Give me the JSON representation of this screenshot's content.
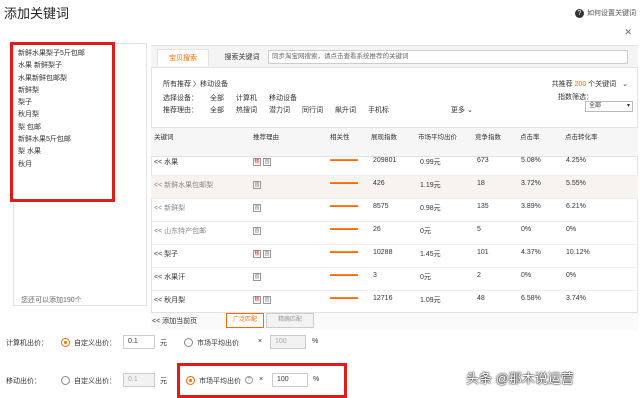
{
  "header": {
    "title": "添加关键词",
    "help_label": "如何设置关键词",
    "help_icon": "?",
    "close_icon": "✕"
  },
  "left": {
    "keywords": [
      "新鲜水果梨子5斤包邮",
      "水果 新鲜梨子",
      "水果新鲜包邮梨",
      "新鲜梨",
      "梨子",
      "秋月梨",
      "梨 包邮",
      "新鲜水果5斤包邮",
      "梨 水果",
      "秋月"
    ],
    "footer": "您还可以添加190个"
  },
  "tabs": {
    "active": "宝贝搜索",
    "other": "搜索关键词"
  },
  "search": {
    "placeholder": "同步淘宝网搜索，请点击查看系统推荐的关键词"
  },
  "filters": {
    "breadcrumb": "所有推荐 〉移动设备",
    "device_label": "选择设备：",
    "devices": [
      "全部",
      "计算机",
      "移动设备"
    ],
    "recommend_label": "推荐理由：",
    "reasons": [
      "全部",
      "热搜词",
      "潜力词",
      "同行词",
      "飙升词",
      "手机标"
    ],
    "more": "更多",
    "total_prefix": "共推荐",
    "total_count": "200",
    "total_suffix": "个关键词",
    "index_filter_label": "指数筛选：",
    "index_filter_value": "全部"
  },
  "table": {
    "headers": [
      "关键词",
      "推荐理由",
      "相关性",
      "展现指数",
      "市场平均出价",
      "竞争指数",
      "点击率",
      "点击转化率"
    ],
    "rows": [
      {
        "kw": "<< 水果",
        "icons": [
          "热",
          "首"
        ],
        "rel": "▬▬▬▬▬",
        "impr": "209801",
        "bid": "0.99元",
        "comp": "673",
        "ctr": "5.08%",
        "cvr": "4.25%",
        "muted": false,
        "hl": false
      },
      {
        "kw": "<< 新鲜水果包邮梨",
        "icons": [
          "首"
        ],
        "rel": "▬▬▬▬▬",
        "impr": "426",
        "bid": "1.19元",
        "comp": "18",
        "ctr": "3.72%",
        "cvr": "5.55%",
        "muted": true,
        "hl": true
      },
      {
        "kw": "<< 新鲜梨",
        "icons": [
          "首"
        ],
        "rel": "▬▬▬▬▬",
        "impr": "8575",
        "bid": "0.98元",
        "comp": "135",
        "ctr": "3.89%",
        "cvr": "6.21%",
        "muted": true,
        "hl": false
      },
      {
        "kw": "<< 山东特产包邮",
        "icons": [
          "首"
        ],
        "rel": "▬▬▬▬▬",
        "impr": "26",
        "bid": "0元",
        "comp": "5",
        "ctr": "0%",
        "cvr": "0%",
        "muted": true,
        "hl": false
      },
      {
        "kw": "<< 梨子",
        "icons": [
          "热",
          "首"
        ],
        "rel": "▬▬▬▬▬",
        "impr": "10288",
        "bid": "1.45元",
        "comp": "101",
        "ctr": "4.37%",
        "cvr": "10.12%",
        "muted": false,
        "hl": false
      },
      {
        "kw": "<< 水果汗",
        "icons": [
          "首"
        ],
        "rel": "▬▬▬▬▬",
        "impr": "3",
        "bid": "0元",
        "comp": "2",
        "ctr": "0%",
        "cvr": "0%",
        "muted": false,
        "hl": false
      },
      {
        "kw": "<< 秋月梨",
        "icons": [
          "热",
          "首"
        ],
        "rel": "▬▬▬▬▬",
        "impr": "12716",
        "bid": "1.09元",
        "comp": "48",
        "ctr": "6.58%",
        "cvr": "3.74%",
        "muted": false,
        "hl": false
      }
    ],
    "footer_add": "<< 添加当前页",
    "btn_broad": "广泛匹配",
    "btn_exact": "精确匹配"
  },
  "bids": {
    "pc_label": "计算机出价：",
    "pc_custom": "自定义出价：",
    "pc_value": "0.1",
    "unit": "元",
    "pc_market": "市场平均出价",
    "pc_pct": "100",
    "percent": "%",
    "times": "×",
    "mobile_label": "移动出价：",
    "mobile_custom": "自定义出价：",
    "mobile_value": "0.1",
    "mobile_market": "市场平均出价",
    "mobile_pct": "100",
    "info_icon": "?"
  },
  "watermark": "头条 @那木说运营"
}
